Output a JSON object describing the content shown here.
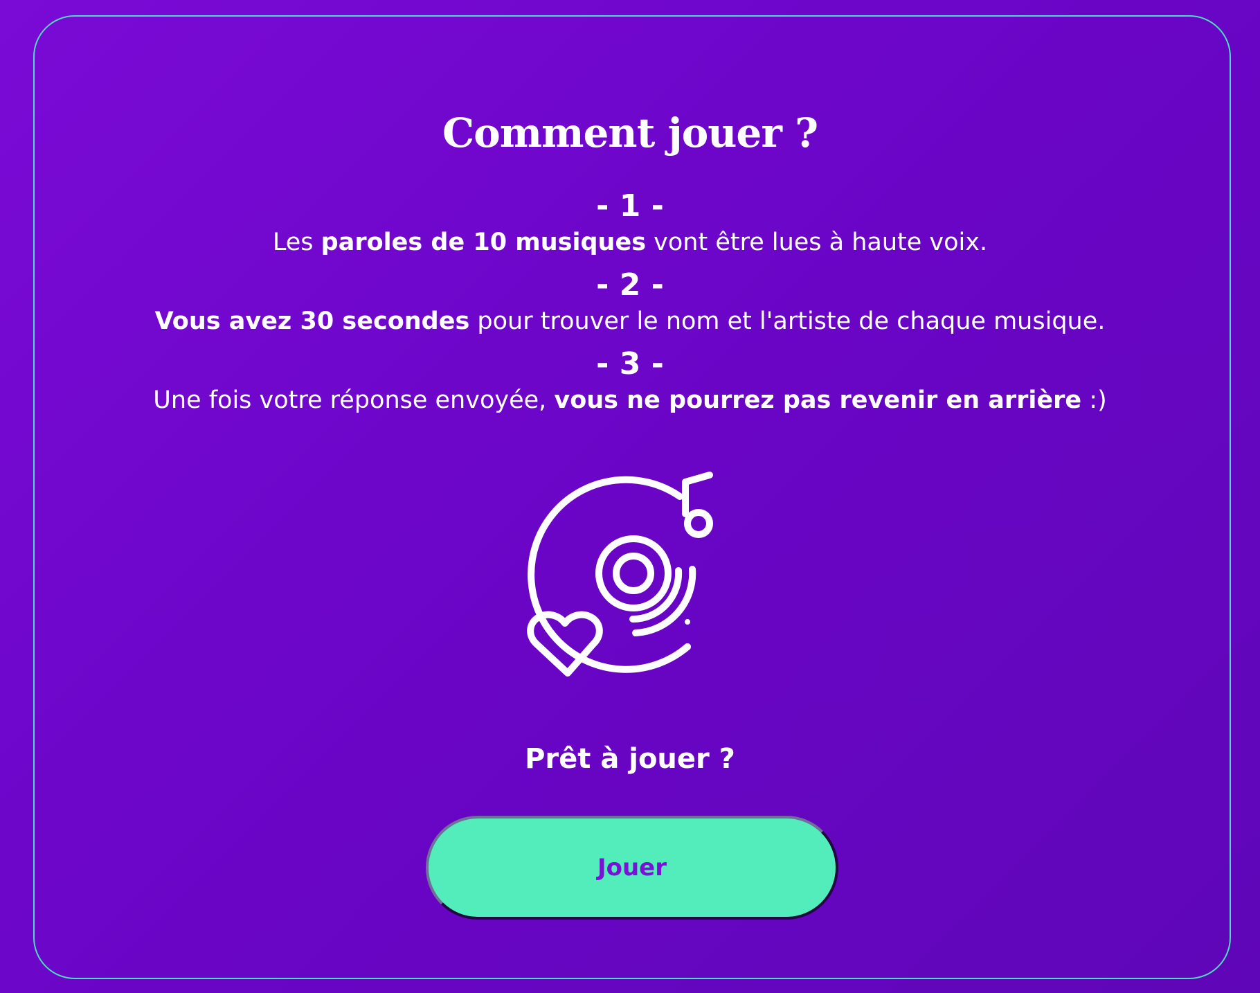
{
  "title": "Comment jouer ?",
  "steps": [
    {
      "number": "- 1 -",
      "parts": [
        "Les ",
        "paroles de 10 musiques",
        " vont être lues à haute voix."
      ]
    },
    {
      "number": "- 2 -",
      "parts": [
        "Vous avez 30 secondes",
        " pour trouver le nom et l'artiste de chaque musique."
      ]
    },
    {
      "number": "- 3 -",
      "parts": [
        "Une fois votre réponse envoyée, ",
        "vous ne pourrez pas revenir en arrière",
        " :)"
      ]
    }
  ],
  "icon": "vinyl-record-heart-icon",
  "ready_text": "Prêt à jouer ?",
  "play_button_label": "Jouer",
  "colors": {
    "background": "#7009cf",
    "card_border": "#4fdcc2",
    "button": "#52edbb",
    "button_text": "#7a12d6",
    "text": "#ffffff"
  }
}
